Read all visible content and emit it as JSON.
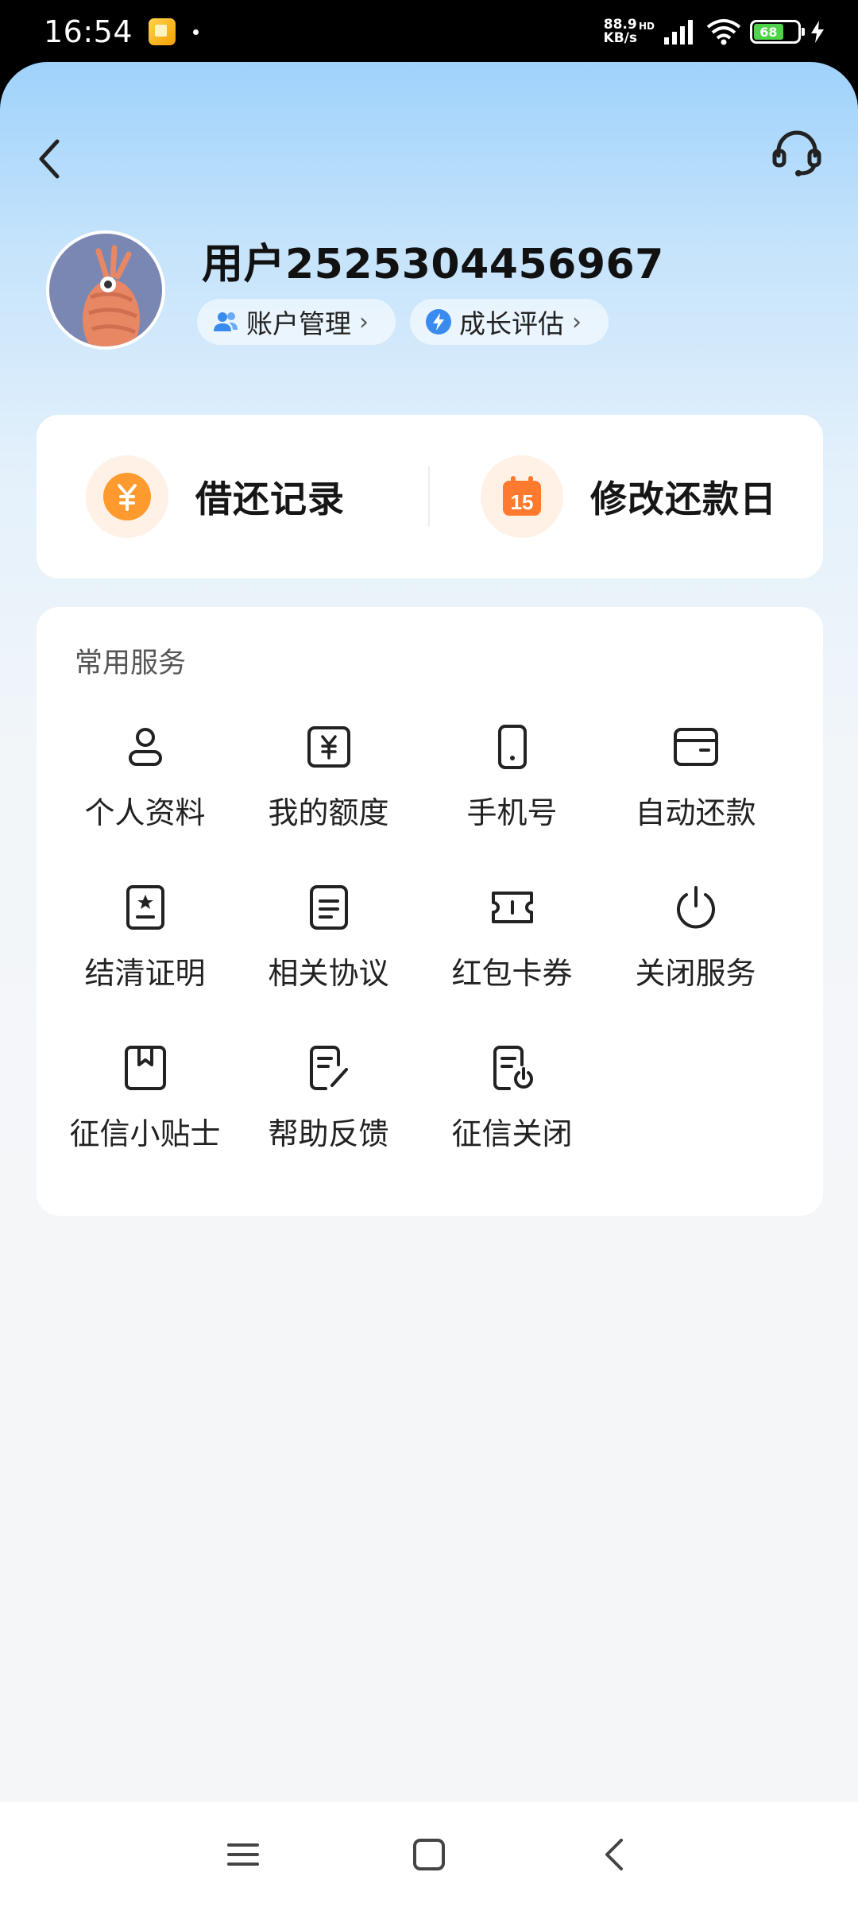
{
  "status_bar": {
    "time": "16:54",
    "network_speed_value": "88.9",
    "network_speed_unit": "KB/s",
    "hd_badge": "HD",
    "battery_level": "68"
  },
  "header": {
    "back_icon": "chevron-left-icon",
    "support_icon": "headset-icon"
  },
  "profile": {
    "username": "用户2525304456967",
    "account_pill": "账户管理",
    "growth_pill": "成长评估",
    "pill_chevron": "›"
  },
  "quick_actions": [
    {
      "label": "借还记录",
      "icon": "yuan-coin-icon"
    },
    {
      "label": "修改还款日",
      "icon": "calendar-15-icon",
      "badge": "15"
    }
  ],
  "services": {
    "title": "常用服务",
    "items": [
      {
        "label": "个人资料",
        "icon": "person-icon"
      },
      {
        "label": "我的额度",
        "icon": "credit-limit-icon"
      },
      {
        "label": "手机号",
        "icon": "phone-icon"
      },
      {
        "label": "自动还款",
        "icon": "wallet-icon"
      },
      {
        "label": "结清证明",
        "icon": "certificate-icon"
      },
      {
        "label": "相关协议",
        "icon": "document-icon"
      },
      {
        "label": "红包卡券",
        "icon": "ticket-icon"
      },
      {
        "label": "关闭服务",
        "icon": "power-icon"
      },
      {
        "label": "征信小贴士",
        "icon": "bookmark-icon"
      },
      {
        "label": "帮助反馈",
        "icon": "edit-note-icon"
      },
      {
        "label": "征信关闭",
        "icon": "document-power-icon"
      }
    ]
  },
  "colors": {
    "accent_orange": "#ff8a1f",
    "pill_icon_blue": "#3a8bef"
  }
}
